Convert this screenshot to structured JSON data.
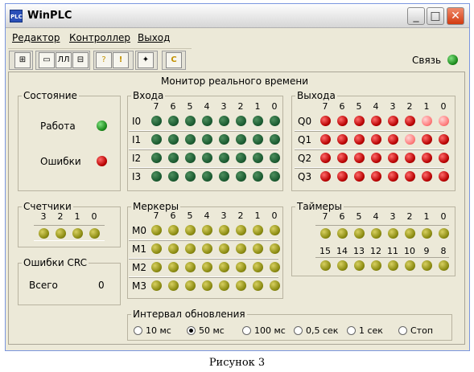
{
  "window": {
    "title": "WinPLC",
    "icon": "PLC",
    "minimize": "_",
    "maximize": "□",
    "close": "✕"
  },
  "menu": [
    "Редактор",
    "Контроллер",
    "Выход"
  ],
  "toolbar": {
    "connection_label": "Связь",
    "connection_color": "#22aa22",
    "buttons": [
      "⊞",
      "▭",
      "ЛЛ",
      "⊟",
      "?",
      "!",
      "✦",
      "C"
    ]
  },
  "monitor_title": "Монитор реального времени",
  "state": {
    "legend": "Состояние",
    "work_label": "Работа",
    "work_color": "#22cc22",
    "errors_label": "Ошибки",
    "errors_color": "#aa0000"
  },
  "inputs": {
    "legend": "Входа",
    "bits": [
      "7",
      "6",
      "5",
      "4",
      "3",
      "2",
      "1",
      "0"
    ],
    "rows": [
      "I0",
      "I1",
      "I2",
      "I3"
    ]
  },
  "outputs": {
    "legend": "Выхода",
    "bits": [
      "7",
      "6",
      "5",
      "4",
      "3",
      "2",
      "1",
      "0"
    ],
    "rows": [
      "Q0",
      "Q1",
      "Q2",
      "Q3"
    ],
    "states": [
      [
        "r",
        "r",
        "r",
        "r",
        "r",
        "r",
        "p",
        "p"
      ],
      [
        "r",
        "r",
        "r",
        "r",
        "r",
        "p",
        "r",
        "r"
      ],
      [
        "r",
        "r",
        "r",
        "r",
        "r",
        "r",
        "r",
        "r"
      ],
      [
        "r",
        "r",
        "r",
        "r",
        "r",
        "r",
        "r",
        "r"
      ]
    ]
  },
  "counters": {
    "legend": "Счетчики",
    "bits": [
      "3",
      "2",
      "1",
      "0"
    ]
  },
  "crc": {
    "legend": "Ошибки CRC",
    "total_label": "Всего",
    "total_value": "0"
  },
  "markers": {
    "legend": "Меркеры",
    "bits": [
      "7",
      "6",
      "5",
      "4",
      "3",
      "2",
      "1",
      "0"
    ],
    "rows": [
      "M0",
      "M1",
      "M2",
      "M3"
    ]
  },
  "timers": {
    "legend": "Таймеры",
    "bits_high": [
      "7",
      "6",
      "5",
      "4",
      "3",
      "2",
      "1",
      "0"
    ],
    "bits_low": [
      "15",
      "14",
      "13",
      "12",
      "11",
      "10",
      "9",
      "8"
    ]
  },
  "interval": {
    "legend": "Интервал обновления",
    "options": [
      "10 мс",
      "50 мс",
      "100 мс",
      "0,5 сек",
      "1 сек",
      "Стоп"
    ],
    "selected": "50 мс"
  },
  "caption": "Рисунок 3"
}
